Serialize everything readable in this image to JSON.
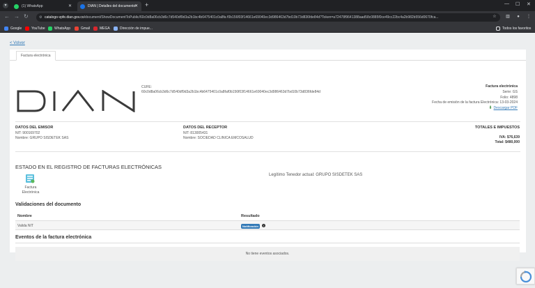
{
  "browser": {
    "tabs": [
      {
        "title": "(1) WhatsApp",
        "favicon_color": "#25d366"
      },
      {
        "title": "DIAN | Detalles del documento",
        "favicon_color": "#1a73e8"
      }
    ],
    "url_host": "catalogo-vpfe.dian.gov.co",
    "url_path": "/document/ShowDocumentToPublic/60c0d8a06cb3d6c7d540df9d3a2b1bc4b6475401c0a8fa f0b156f03f14661e69040ec3d986463d7bd10b73d836fde84d?Token=a72478f9641388aad58c0885f0ce49cc22bc4a2b982b556d0670fca...",
    "bookmarks": [
      {
        "label": "Google",
        "icon": "google-icon",
        "color": "#4285f4"
      },
      {
        "label": "YouTube",
        "icon": "youtube-icon",
        "color": "#ff0000"
      },
      {
        "label": "WhatsApp",
        "icon": "whatsapp-icon",
        "color": "#25d366"
      },
      {
        "label": "Gmail",
        "icon": "gmail-icon",
        "color": "#ea4335"
      },
      {
        "label": "MEGA",
        "icon": "mega-icon",
        "color": "#d9272e"
      },
      {
        "label": "Dirección de impue...",
        "icon": "dian-icon",
        "color": "#8ab4f8"
      }
    ],
    "all_bookmarks": "Todos los favoritos"
  },
  "page": {
    "back_link": "< Volver",
    "doc_tab": "Factura electrónica",
    "logo_text": "DIAN",
    "cufe_label": "CUFE:",
    "cufe_value": "60c0d8a06cb3d6c7d540df9d3a2b1bc4b6475401c0a8faf0b156f03f14661e69040ec3d986463d7bd10b73d836fde84d",
    "factura": {
      "title": "Factura electrónica",
      "serie": "Serie: GS",
      "folio": "Folio: 4898",
      "fecha": "Fecha de emisión de la factura Electrónica: 13-03-2024",
      "download": "Descargar PDF"
    },
    "emisor": {
      "heading": "DATOS DEL EMISOR",
      "nit": "NIT: 900169702",
      "nombre": "Nombre: GRUPO SISDETEK SAS"
    },
    "receptor": {
      "heading": "DATOS DEL RECEPTOR",
      "nit": "NIT: 813005431",
      "nombre": "Nombre: SOCIEDAD CLINICA EMCOSALUD"
    },
    "totales": {
      "heading": "TOTALES E IMPUESTOS",
      "iva": "IVA: $76,639",
      "total": "Total: $480,000"
    },
    "estado_heading": "ESTADO EN EL REGISTRO DE FACTURAS ELECTRÓNICAS",
    "estado_item": "Factura Electrónica",
    "tenedor": "Legítimo Tenedor actual: GRUPO SISDETEK SAS",
    "validaciones": {
      "heading": "Validaciones del documento",
      "col_nombre": "Nombre",
      "col_resultado": "Resultado",
      "rows": [
        {
          "nombre": "Valida NIT",
          "resultado": "Notificación"
        }
      ]
    },
    "eventos": {
      "heading": "Eventos de la factura electrónica",
      "empty": "No tiene eventos asociados."
    }
  }
}
